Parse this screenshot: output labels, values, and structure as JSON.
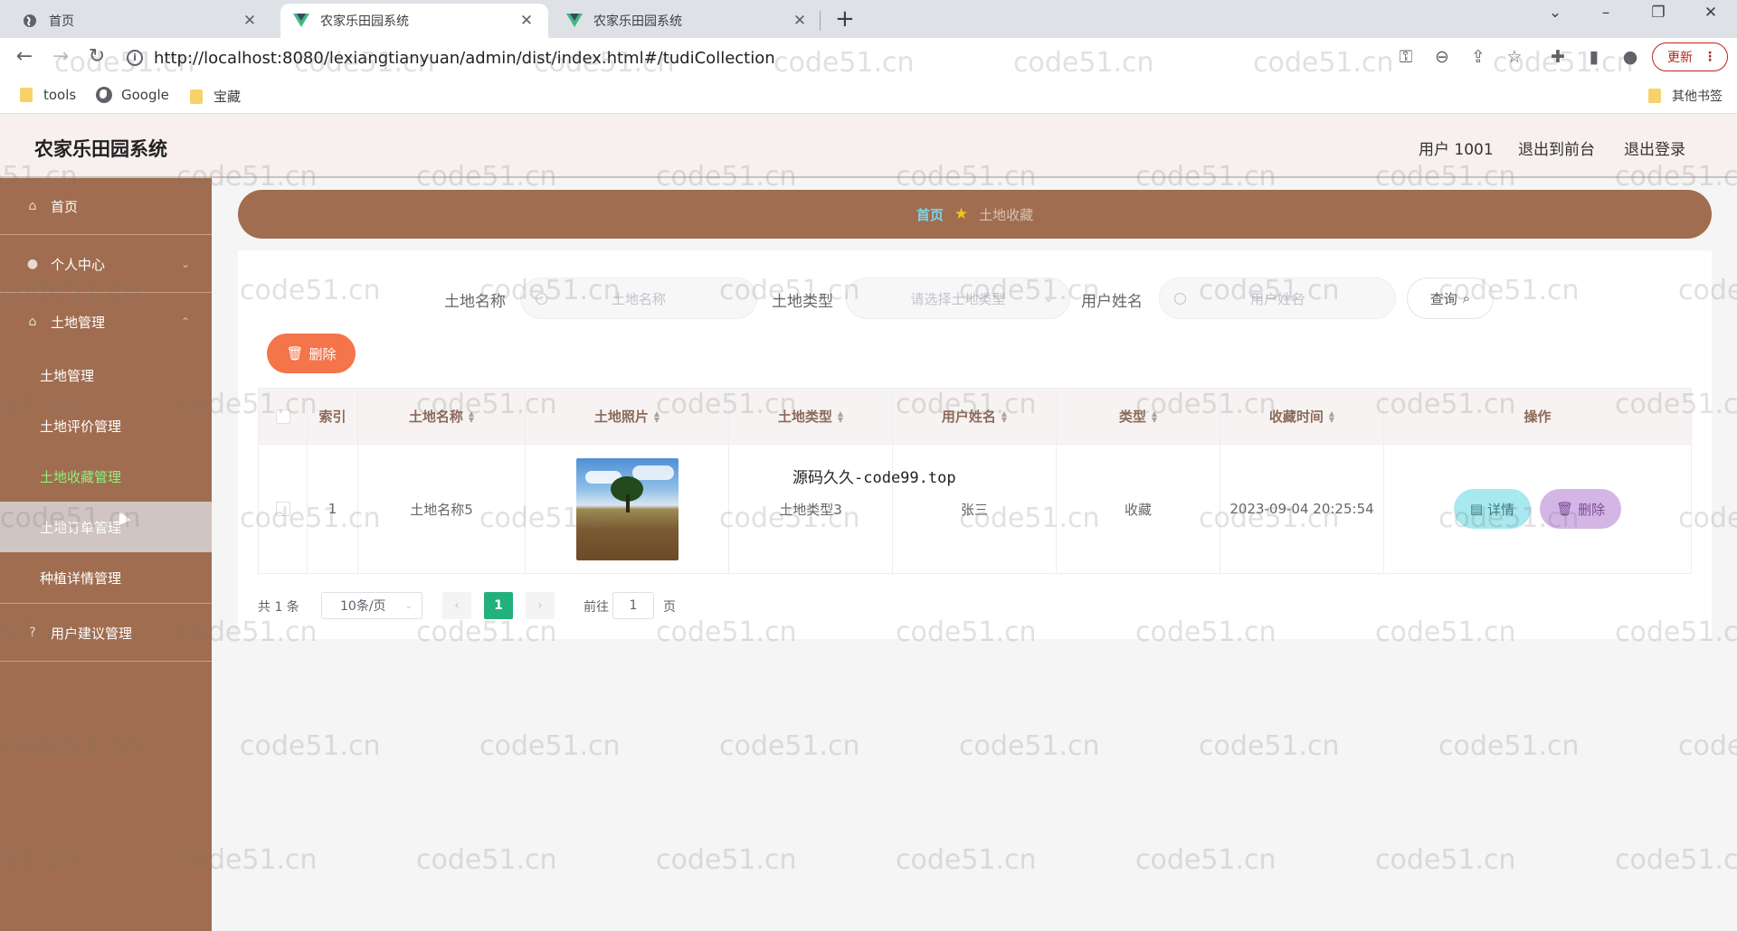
{
  "browser": {
    "tabs": [
      {
        "title": "首页",
        "active": false
      },
      {
        "title": "农家乐田园系统",
        "active": true
      },
      {
        "title": "农家乐田园系统",
        "active": false
      }
    ],
    "url": "http://localhost:8080/lexiangtianyuan/admin/dist/index.html#/tudiCollection",
    "update_label": "更新",
    "bookmarks": [
      "tools",
      "Google",
      "宝藏"
    ],
    "other_bookmarks": "其他书签"
  },
  "header": {
    "title": "农家乐田园系统",
    "user": "用户 1001",
    "to_front": "退出到前台",
    "logout": "退出登录"
  },
  "sidebar": {
    "home": "首页",
    "personal": "个人中心",
    "land_mgmt": "土地管理",
    "sub": [
      "土地管理",
      "土地评价管理",
      "土地收藏管理",
      "土地订单管理",
      "种植详情管理"
    ],
    "suggest": "用户建议管理"
  },
  "breadcrumb": {
    "home": "首页",
    "current": "土地收藏"
  },
  "filters": {
    "land_name_label": "土地名称",
    "land_name_placeholder": "土地名称",
    "land_type_label": "土地类型",
    "land_type_placeholder": "请选择土地类型",
    "user_name_label": "用户姓名",
    "user_name_placeholder": "用户姓名",
    "query_label": "查询"
  },
  "actions": {
    "delete": "删除"
  },
  "table": {
    "columns": [
      "索引",
      "土地名称",
      "土地照片",
      "土地类型",
      "用户姓名",
      "类型",
      "收藏时间",
      "操作"
    ],
    "rows": [
      {
        "index": "1",
        "land_name": "土地名称5",
        "land_type": "土地类型3",
        "user_name": "张三",
        "type": "收藏",
        "time": "2023-09-04 20:25:54"
      }
    ],
    "detail_label": "详情",
    "delete_label": "删除"
  },
  "overlay_text": "源码久久-code99.top",
  "pagination": {
    "total": "共 1 条",
    "page_size": "10条/页",
    "current": "1",
    "goto_prefix": "前往",
    "goto_value": "1",
    "goto_suffix": "页"
  },
  "watermark": "code51.cn",
  "colors": {
    "sidebar": "#a06d50",
    "accent_green": "#22b07d",
    "delete_orange": "#f37549",
    "header_bg": "#f7f0ef"
  }
}
